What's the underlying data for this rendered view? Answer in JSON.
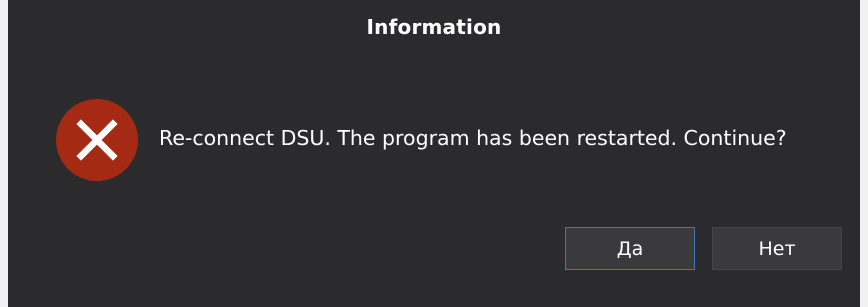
{
  "dialog": {
    "title": "Information",
    "icon": "error-x-icon",
    "message": "Re-connect DSU. The program has been restarted. Continue?",
    "buttons": {
      "yes_label": "Да",
      "no_label": "Нет"
    }
  },
  "colors": {
    "background": "#2b2b2d",
    "icon_circle": "#a52a14",
    "button_bg": "#3a3a3c",
    "focus_border": "#3a79c2",
    "text": "#ffffff"
  }
}
